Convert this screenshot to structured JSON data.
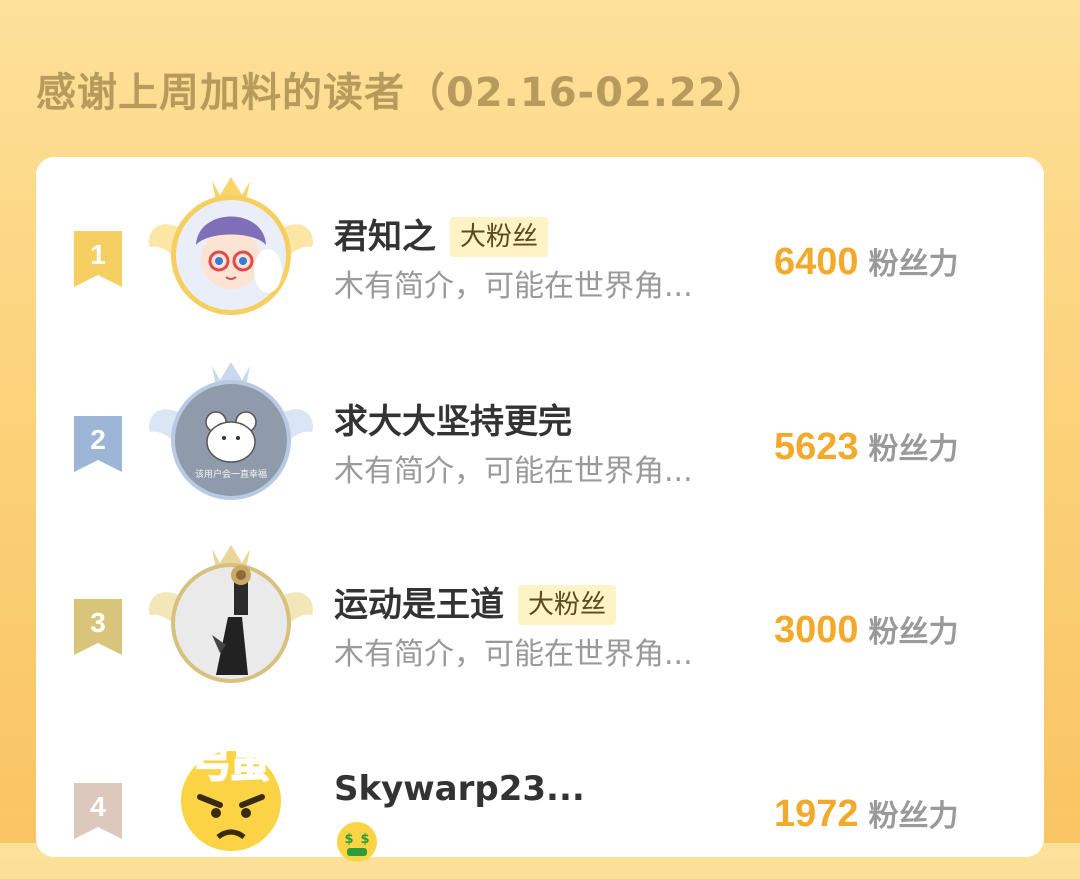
{
  "header": {
    "title": "感谢上周加料的读者（02.16-02.22）"
  },
  "readers": [
    {
      "rank": "1",
      "name": "君知之",
      "badge": "大粉丝",
      "bio": "木有简介，可能在世界角...",
      "power_value": "6400",
      "power_unit": "粉丝力",
      "rank_color": "#f6cf63",
      "avatar_icon": "anime-boy-avatar",
      "frame": "gold-crown-wings"
    },
    {
      "rank": "2",
      "name": "求大大坚持更完",
      "badge": "",
      "bio": "木有简介，可能在世界角...",
      "power_value": "5623",
      "power_unit": "粉丝力",
      "rank_color": "#9db6d8",
      "avatar_icon": "bear-sketch-avatar",
      "avatar_caption": "该用户会一直幸福",
      "frame": "silver-crown-wings"
    },
    {
      "rank": "3",
      "name": "运动是王道",
      "badge": "大粉丝",
      "bio": "木有简介，可能在世界角...",
      "power_value": "3000",
      "power_unit": "粉丝力",
      "rank_color": "#d9c57a",
      "avatar_icon": "trophy-athlete-avatar",
      "frame": "bronze-crown-wings"
    },
    {
      "rank": "4",
      "name": "Skywarp23...",
      "badge": "",
      "bio": "",
      "power_value": "1972",
      "power_unit": "粉丝力",
      "rank_color": "#dcc8bd",
      "avatar_icon": "angry-emoji-avatar",
      "avatar_caption": "弓虽",
      "status_icon": "money-mouth-emoji-icon"
    }
  ],
  "colors": {
    "accent": "#f3aa2b",
    "title": "#b89a5d",
    "badge_bg": "#fdf3c4"
  }
}
